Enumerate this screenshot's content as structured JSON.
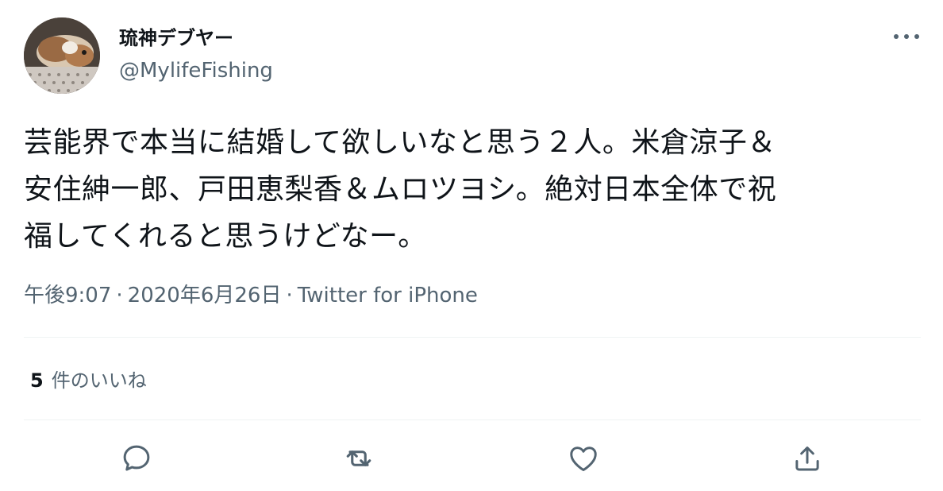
{
  "user": {
    "display_name": "琉神デブヤー",
    "handle": "@MylifeFishing",
    "avatar_icon": "guinea-pig-avatar"
  },
  "tweet": {
    "text": "芸能界で本当に結婚して欲しいなと思う２人。米倉涼子＆\n安住紳一郎、戸田恵梨香＆ムロツヨシ。絶対日本全体で祝\n福してくれると思うけどなー。",
    "time": "午後9:07",
    "date": "2020年6月26日",
    "separator": "·",
    "source": "Twitter for iPhone"
  },
  "likes": {
    "count": "5",
    "label": "件のいいね"
  },
  "icons": {
    "more": "more-icon",
    "reply": "reply-icon",
    "retweet": "retweet-icon",
    "like": "like-icon",
    "share": "share-icon"
  },
  "colors": {
    "text": "#0f1419",
    "secondary": "#536471",
    "divider": "#eff3f4"
  }
}
